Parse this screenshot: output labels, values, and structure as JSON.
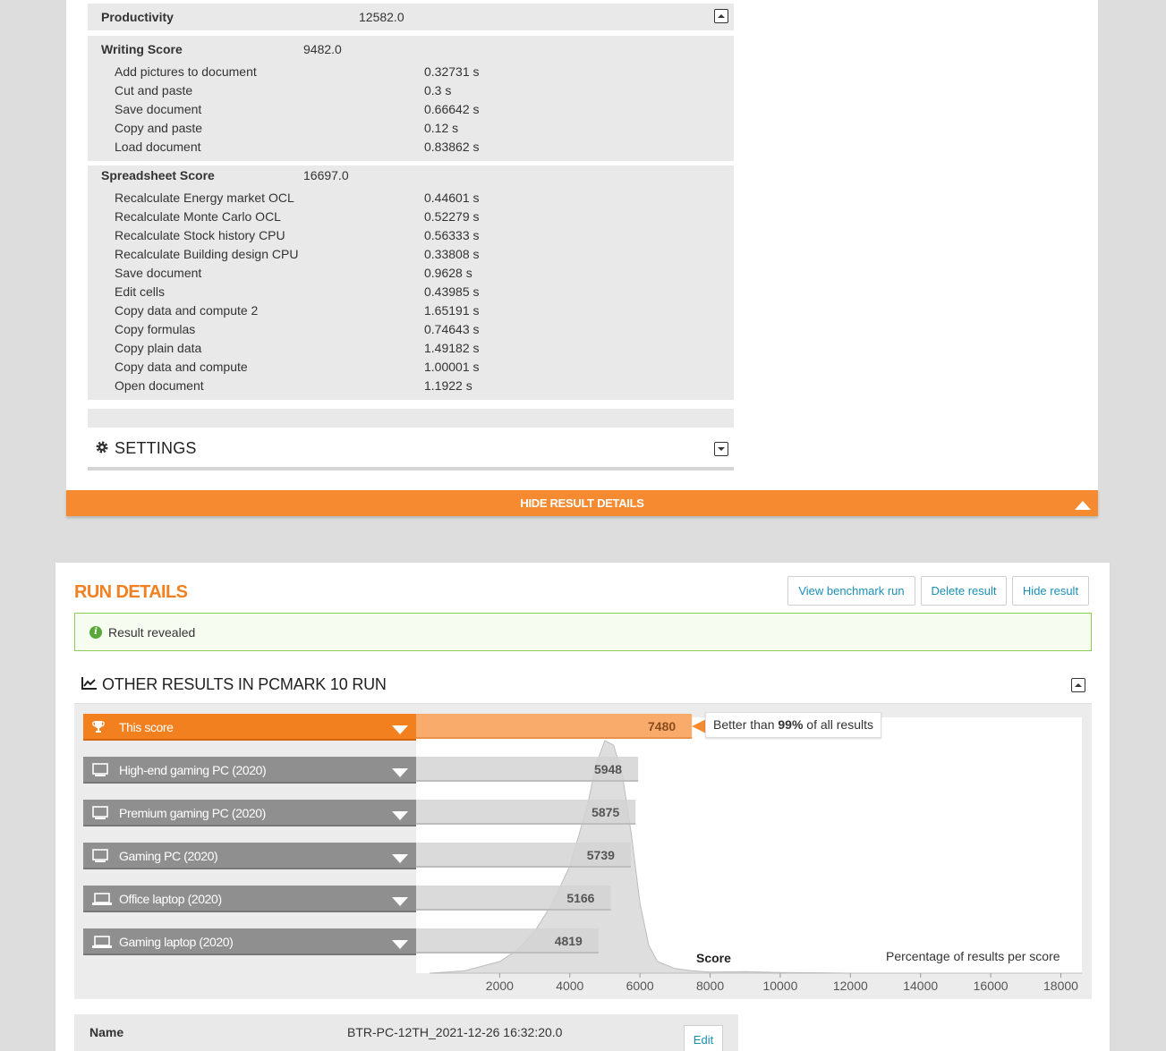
{
  "productivity": {
    "label": "Productivity",
    "score": "12582.0",
    "writing": {
      "label": "Writing Score",
      "score": "9482.0",
      "items": [
        {
          "name": "Add pictures to document",
          "value": "0.32731 s"
        },
        {
          "name": "Cut and paste",
          "value": "0.3 s"
        },
        {
          "name": "Save document",
          "value": "0.66642 s"
        },
        {
          "name": "Copy and paste",
          "value": "0.12 s"
        },
        {
          "name": "Load document",
          "value": "0.83862 s"
        }
      ]
    },
    "spreadsheet": {
      "label": "Spreadsheet Score",
      "score": "16697.0",
      "items": [
        {
          "name": "Recalculate Energy market OCL",
          "value": "0.44601 s"
        },
        {
          "name": "Recalculate Monte Carlo OCL",
          "value": "0.52279 s"
        },
        {
          "name": "Recalculate Stock history CPU",
          "value": "0.56333 s"
        },
        {
          "name": "Recalculate Building design CPU",
          "value": "0.33808 s"
        },
        {
          "name": "Save document",
          "value": "0.9628 s"
        },
        {
          "name": "Edit cells",
          "value": "0.43985 s"
        },
        {
          "name": "Copy data and compute 2",
          "value": "1.65191 s"
        },
        {
          "name": "Copy formulas",
          "value": "0.74643 s"
        },
        {
          "name": "Copy plain data",
          "value": "1.49182 s"
        },
        {
          "name": "Copy data and compute",
          "value": "1.00001 s"
        },
        {
          "name": "Open document",
          "value": "1.1922 s"
        }
      ]
    }
  },
  "settings": {
    "label": "SETTINGS"
  },
  "hide_details": {
    "label": "HIDE RESULT DETAILS"
  },
  "run_details": {
    "title": "RUN DETAILS",
    "buttons": {
      "view": "View benchmark run",
      "delete": "Delete result",
      "hide": "Hide result"
    },
    "notice": "Result revealed"
  },
  "other_results": {
    "title": "OTHER RESULTS IN PCMARK 10 RUN",
    "better_than": {
      "prefix": "Better than ",
      "percent": "99%",
      "suffix": " of all results"
    },
    "xlabel": "Score",
    "ylabel": "Percentage of results per score"
  },
  "chart_data": {
    "type": "bar",
    "categories": [
      "This score",
      "High-end gaming PC (2020)",
      "Premium gaming PC (2020)",
      "Gaming PC (2020)",
      "Office laptop (2020)",
      "Gaming laptop (2020)"
    ],
    "values": [
      7480,
      5948,
      5875,
      5739,
      5166,
      4819
    ],
    "value_labels": [
      "7480",
      "5948",
      "5875",
      "5739",
      "5166",
      "4819"
    ],
    "xlim": [
      0,
      18600
    ],
    "x_ticks": [
      2000,
      4000,
      6000,
      8000,
      10000,
      12000,
      14000,
      16000,
      18000
    ],
    "x_tick_labels": [
      "2000",
      "4000",
      "6000",
      "8000",
      "10000",
      "12000",
      "14000",
      "16000",
      "18000"
    ],
    "distribution": {
      "x": [
        0,
        1000,
        2000,
        2500,
        3000,
        3500,
        4000,
        4500,
        4750,
        5000,
        5250,
        5500,
        5750,
        6000,
        6250,
        6500,
        7000,
        7500,
        8000,
        9000,
        10000,
        11000,
        12000
      ],
      "y": [
        0,
        1,
        5,
        10,
        18,
        30,
        46,
        72,
        90,
        100,
        98,
        85,
        60,
        30,
        12,
        5,
        2,
        1,
        0.5,
        0.7,
        0.3,
        0.2,
        0
      ]
    },
    "highlight_color": "#f2801f",
    "reference_color": "#8f8f8f"
  },
  "name_row": {
    "label": "Name",
    "value": "BTR-PC-12TH_2021-12-26 16:32:20.0",
    "edit": "Edit"
  }
}
